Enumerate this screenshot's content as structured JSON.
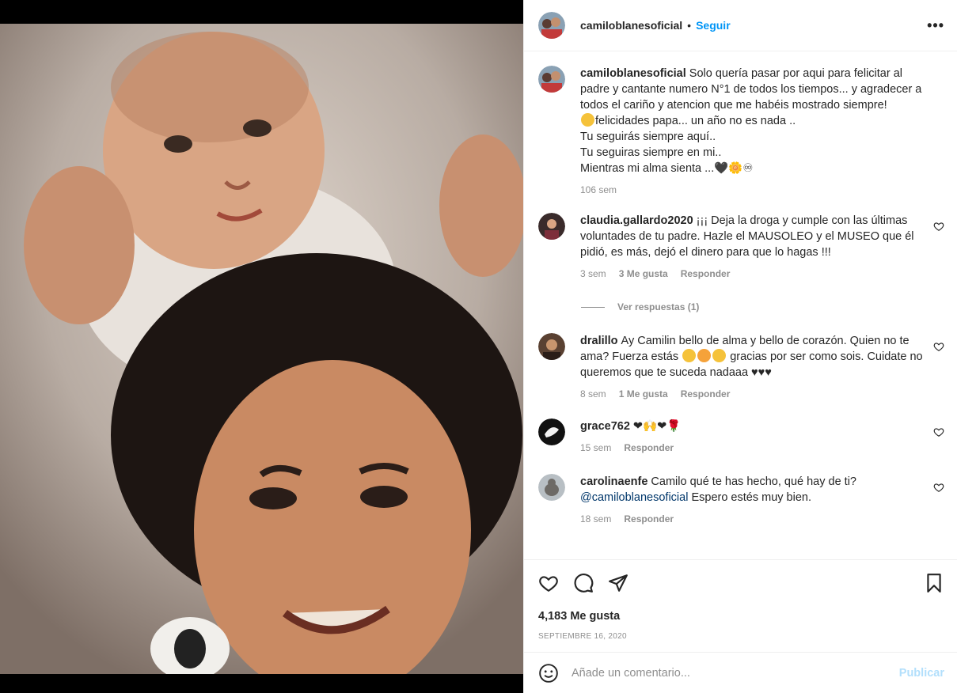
{
  "post": {
    "username": "camiloblanesoficial",
    "follow_label": "Seguir",
    "more_label": "•••"
  },
  "caption": {
    "username": "camiloblanesoficial",
    "text": "Solo quería pasar por aqui para felicitar al padre y cantante numero N°1 de todos los tiempos... y agradecer a todos el cariño y atencion que me habéis mostrado siempre!",
    "line2": "felicidades papa... un año no es nada ..",
    "line3": "Tu seguirás siempre aquí..",
    "line4": "Tu seguiras siempre en mi..",
    "line5": "Mientras mi alma sienta ...🖤🌼♾",
    "time": "106 sem"
  },
  "comments": [
    {
      "username": "claudia.gallardo2020",
      "text": "¡¡¡ Deja la droga y cumple con las últimas voluntades de tu padre. Hazle el MAUSOLEO y el MUSEO que él pidió, es más, dejó el dinero para que lo hagas !!!",
      "time": "3 sem",
      "likes": "3 Me gusta",
      "reply": "Responder"
    },
    {
      "username": "dralillo",
      "text_a": "Ay Camilin bello de alma y bello de corazón. Quien no te ama? Fuerza estás",
      "text_b": "gracias por ser como sois. Cuidate no queremos que te suceda nadaaa ♥♥♥",
      "time": "8 sem",
      "likes": "1 Me gusta",
      "reply": "Responder"
    },
    {
      "username": "grace762",
      "text": "❤🙌❤🌹",
      "time": "15 sem",
      "reply": "Responder"
    },
    {
      "username": "carolinaenfe",
      "text": "Camilo qué te has hecho, qué hay de ti?",
      "mention": "@camiloblanesoficial",
      "text_after": "Espero estés muy bien.",
      "time": "18 sem",
      "reply": "Responder"
    }
  ],
  "view_replies": "Ver respuestas (1)",
  "likes_total": "4,183 Me gusta",
  "date": "SEPTIEMBRE 16, 2020",
  "add_comment": {
    "placeholder": "Añade un comentario...",
    "publish": "Publicar"
  },
  "colors": {
    "accent": "#0095f6",
    "publish_disabled": "#b2dffc",
    "muted": "#8e8e8e"
  }
}
